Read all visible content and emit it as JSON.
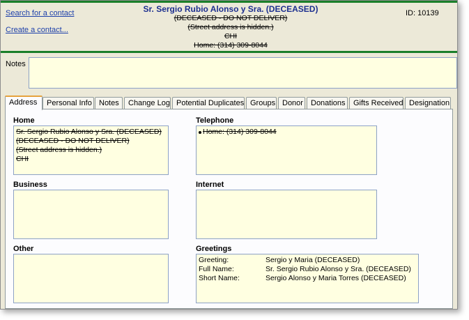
{
  "header": {
    "links": {
      "search": "Search for a contact",
      "create": "Create a contact..."
    },
    "contact": {
      "name": "Sr. Sergio Rubio Alonso y Sra. (DECEASED)",
      "lines": [
        "(DECEASED - DO NOT DELIVER)",
        "(Street address is hidden.)",
        "CHI",
        "Home: (314) 309-8044"
      ]
    },
    "id_text": "ID: 10139"
  },
  "notes": {
    "label": "Notes",
    "value": ""
  },
  "tabs": [
    {
      "label": "Address",
      "active": true
    },
    {
      "label": "Personal Info",
      "active": false
    },
    {
      "label": "Notes",
      "active": false
    },
    {
      "label": "Change Log",
      "active": false
    },
    {
      "label": "Potential Duplicates",
      "active": false
    },
    {
      "label": "Groups",
      "active": false
    },
    {
      "label": "Donor",
      "active": false
    },
    {
      "label": "Donations",
      "active": false
    },
    {
      "label": "Gifts Received",
      "active": false
    },
    {
      "label": "Designation",
      "active": false
    }
  ],
  "address": {
    "home": {
      "title": "Home",
      "lines": [
        "Sr. Sergio Rubio Alonso y Sra. (DECEASED)",
        "(DECEASED - DO NOT DELIVER)",
        "(Street address is hidden.)",
        "CHI"
      ]
    },
    "telephone": {
      "title": "Telephone",
      "entries": [
        "Home: (314) 309-8044"
      ]
    },
    "business": {
      "title": "Business",
      "lines": []
    },
    "internet": {
      "title": "Internet",
      "lines": []
    },
    "other": {
      "title": "Other",
      "lines": []
    },
    "greetings": {
      "title": "Greetings",
      "rows": [
        {
          "label": "Greeting:",
          "value": "Sergio y Maria (DECEASED)"
        },
        {
          "label": "Full Name:",
          "value": "Sr. Sergio Rubio Alonso y Sra. (DECEASED)"
        },
        {
          "label": "Short Name:",
          "value": "Sergio Alonso y Maria Torres (DECEASED)"
        }
      ]
    }
  },
  "colors": {
    "accent_green": "#1a7f2a",
    "link_blue": "#1c3faa",
    "field_yellow": "#ffffe1",
    "active_tab_orange": "#e6a23c"
  }
}
